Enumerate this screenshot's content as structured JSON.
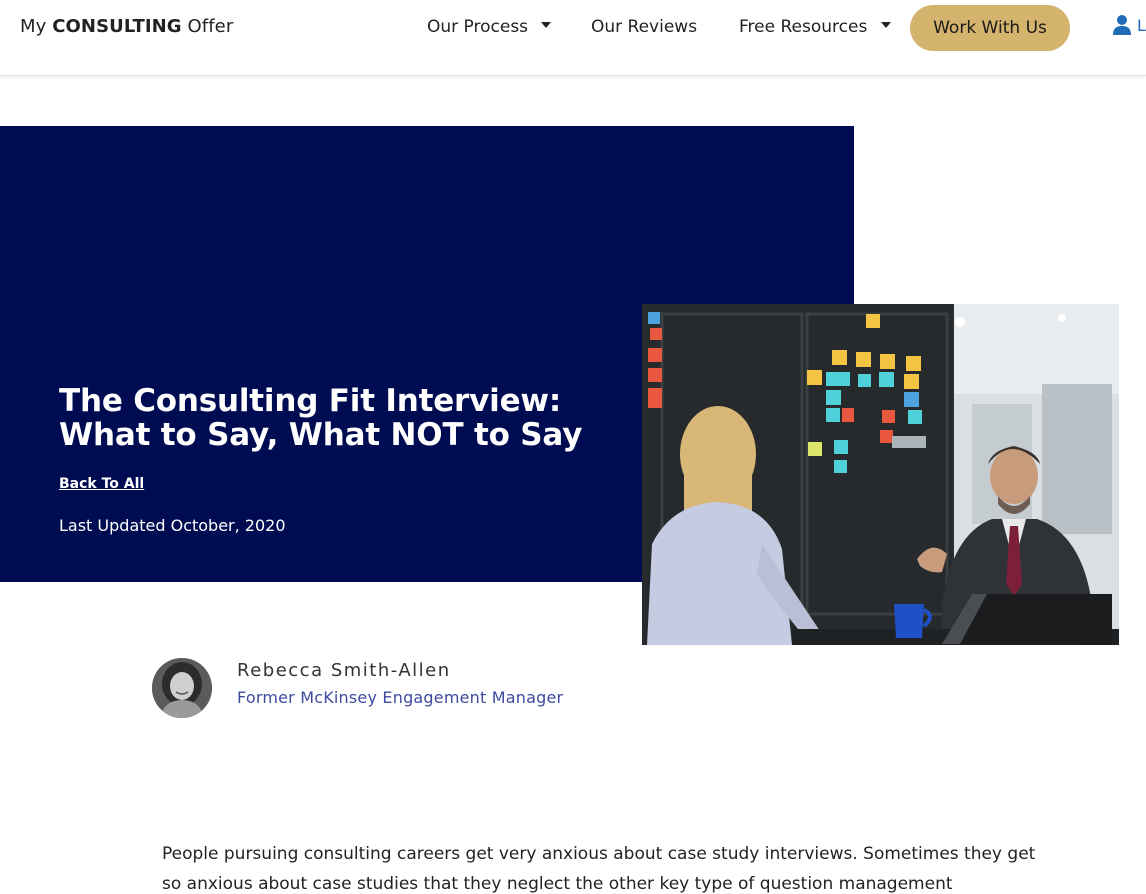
{
  "header": {
    "logo": {
      "prefix": "My",
      "strong": "CONSULTING",
      "suffix": "Offer"
    },
    "nav": [
      {
        "label": "Our Process",
        "has_dropdown": true
      },
      {
        "label": "Our Reviews",
        "has_dropdown": false
      },
      {
        "label": "Free Resources",
        "has_dropdown": true
      }
    ],
    "cta_label": "Work With Us",
    "login_icon": "user-icon",
    "login_text": "L"
  },
  "hero": {
    "title": "The Consulting Fit Interview: What to Say, What NOT to Say",
    "back_link": "Back To All",
    "updated": "Last Updated October, 2020",
    "photo_icon": "meeting-photo"
  },
  "author": {
    "name": "Rebecca Smith-Allen",
    "role": "Former McKinsey Engagement Manager"
  },
  "article": {
    "intro": "People pursuing consulting careers get very anxious about case study interviews. Sometimes they get so anxious about case studies that they neglect the other key type of question management"
  },
  "colors": {
    "hero_bg": "#000c52",
    "cta_bg": "#d4b36c",
    "author_role": "#3e4a9e",
    "login_blue": "#1f6bb8"
  }
}
